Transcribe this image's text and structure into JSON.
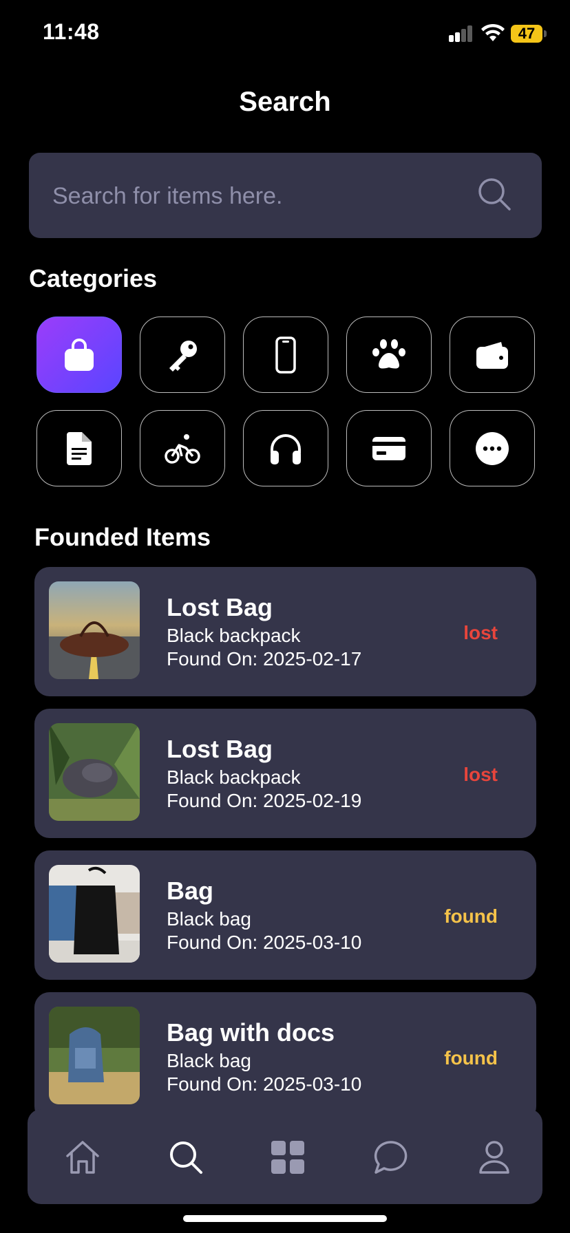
{
  "status_bar": {
    "time": "11:48",
    "battery": "47"
  },
  "header": {
    "title": "Search"
  },
  "search": {
    "placeholder": "Search for items here."
  },
  "categories": {
    "heading": "Categories",
    "items": [
      {
        "icon": "bag-icon",
        "active": true
      },
      {
        "icon": "key-icon",
        "active": false
      },
      {
        "icon": "phone-icon",
        "active": false
      },
      {
        "icon": "paw-icon",
        "active": false
      },
      {
        "icon": "wallet-icon",
        "active": false
      },
      {
        "icon": "document-icon",
        "active": false
      },
      {
        "icon": "bicycle-icon",
        "active": false
      },
      {
        "icon": "headphones-icon",
        "active": false
      },
      {
        "icon": "card-icon",
        "active": false
      },
      {
        "icon": "more-icon",
        "active": false
      }
    ]
  },
  "items_section": {
    "heading": "Founded Items",
    "items": [
      {
        "title": "Lost Bag",
        "description": "Black backpack",
        "date": "Found On: 2025-02-17",
        "status": "lost"
      },
      {
        "title": "Lost Bag",
        "description": "Black backpack",
        "date": "Found On: 2025-02-19",
        "status": "lost"
      },
      {
        "title": "Bag",
        "description": "Black bag",
        "date": "Found On: 2025-03-10",
        "status": "found"
      },
      {
        "title": "Bag with docs",
        "description": "Black bag",
        "date": "Found On: 2025-03-10",
        "status": "found"
      }
    ]
  },
  "bottom_nav": {
    "items": [
      {
        "icon": "home-icon"
      },
      {
        "icon": "search-icon",
        "active": true
      },
      {
        "icon": "grid-icon"
      },
      {
        "icon": "chat-icon"
      },
      {
        "icon": "profile-icon"
      }
    ]
  },
  "colors": {
    "background": "#000000",
    "card": "#35354a",
    "accent_start": "#9b3dfa",
    "accent_end": "#5a45ff",
    "lost": "#e8453c",
    "found": "#f5c34a"
  }
}
